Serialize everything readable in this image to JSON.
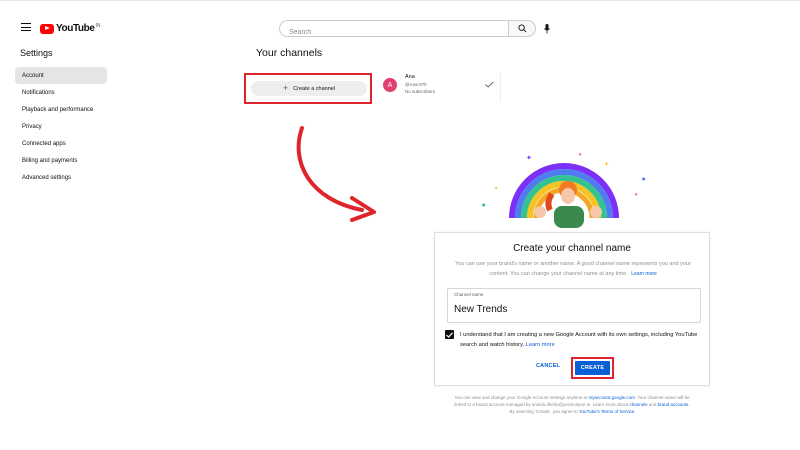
{
  "header": {
    "logo_text": "YouTube",
    "logo_sup": "IN",
    "search_placeholder": "Search"
  },
  "sidebar": {
    "title": "Settings",
    "items": [
      {
        "label": "Account",
        "active": true
      },
      {
        "label": "Notifications"
      },
      {
        "label": "Playback and performance"
      },
      {
        "label": "Privacy"
      },
      {
        "label": "Connected apps"
      },
      {
        "label": "Billing and payments"
      },
      {
        "label": "Advanced settings"
      }
    ]
  },
  "main": {
    "title": "Your channels",
    "create_channel_label": "Create a channel",
    "channel": {
      "avatar_letter": "A",
      "name": "Ana",
      "handle": "@Ana-07h",
      "subscribers": "No subscribers"
    }
  },
  "dialog": {
    "title": "Create your channel name",
    "description": "You can use your brand's name or another name. A good channel name represents you and your content. You can change your channel name at any time.",
    "learn_more": "Learn more",
    "field_label": "Channel name",
    "field_value": "New Trends",
    "checkbox_text": "I understand that I am creating a new Google Account with its own settings, including YouTube search and watch history.",
    "checkbox_learn_more": "Learn more",
    "cancel_label": "CANCEL",
    "create_label": "CREATE"
  },
  "footer": {
    "line1_pre": "You can view and change your Google Account settings anytime at ",
    "line1_link": "myaccount.google.com",
    "line1_post": ". Your channel name will be linked to a brand account managed by anasia.dhello@promodyne.in. Learn more about ",
    "link_channels": "channels",
    "and_text": " and ",
    "link_brand": "brand accounts",
    "line2_post": ". By selecting 'Create', you agree to ",
    "link_terms": "YouTube's Terms of Service"
  },
  "colors": {
    "brand_red": "#ff0000",
    "link_blue": "#065fd4",
    "highlight_red": "#e0242b",
    "avatar_pink": "#e2406e"
  }
}
